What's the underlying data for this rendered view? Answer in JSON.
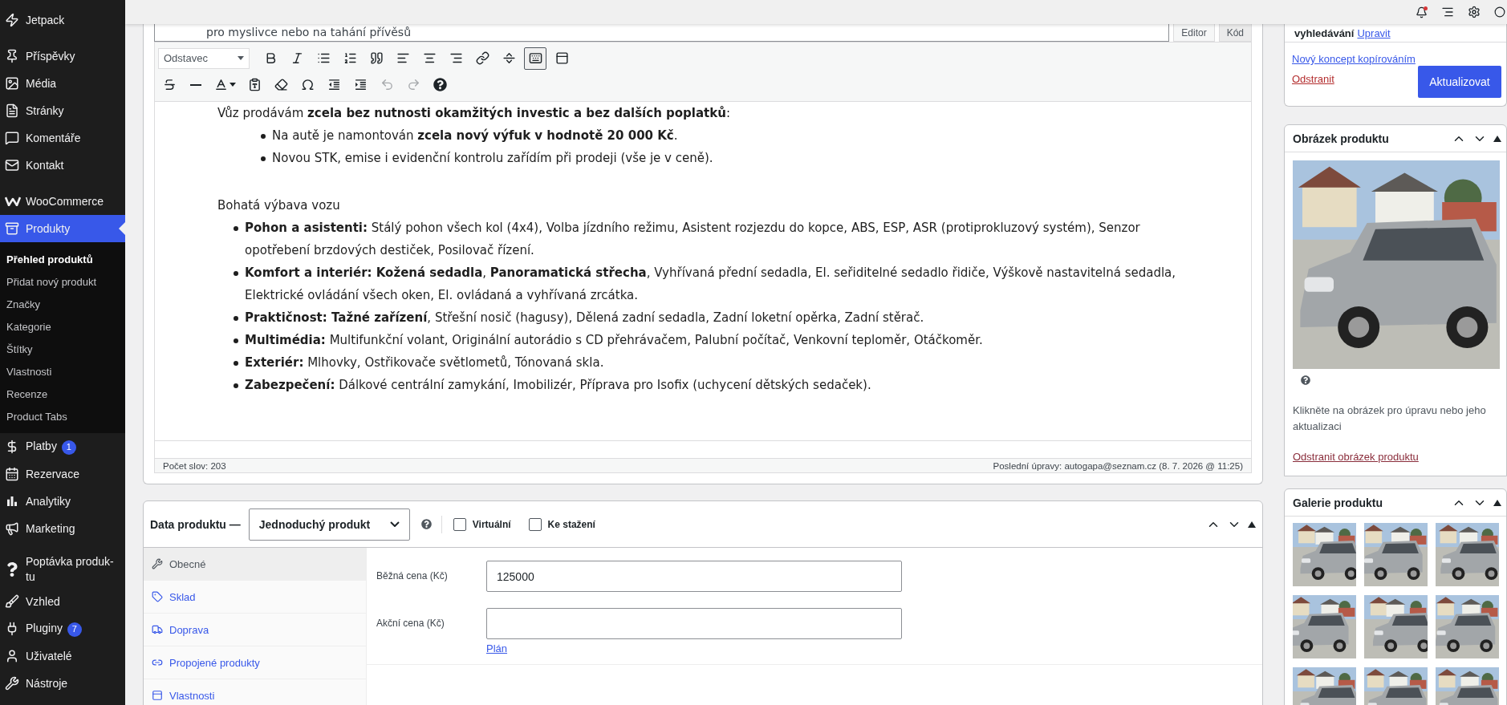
{
  "sidebar": {
    "groups": [
      {
        "items": [
          {
            "label": "Jetpack",
            "selected": false
          }
        ]
      },
      {
        "items": [
          {
            "label": "Příspěvky",
            "selected": false
          },
          {
            "label": "Média",
            "selected": false
          },
          {
            "label": "Stránky",
            "selected": false
          },
          {
            "label": "Komentáře",
            "selected": false
          },
          {
            "label": "Kontakt",
            "selected": false
          }
        ]
      },
      {
        "items": [
          {
            "label": "WooCommerce",
            "selected": false
          },
          {
            "label": "Produkty",
            "selected": true,
            "submenu": [
              {
                "label": "Přehled produktů",
                "selected": true
              },
              {
                "label": "Přidat nový produkt",
                "selected": false
              },
              {
                "label": "Značky",
                "selected": false
              },
              {
                "label": "Kategorie",
                "selected": false
              },
              {
                "label": "Štítky",
                "selected": false
              },
              {
                "label": "Vlastnosti",
                "selected": false
              },
              {
                "label": "Recenze",
                "selected": false
              },
              {
                "label": "Product Tabs",
                "selected": false
              }
            ]
          },
          {
            "label": "Platby",
            "selected": false,
            "badge": "1"
          },
          {
            "label": "Rezervace",
            "selected": false
          },
          {
            "label": "Analytiky",
            "selected": false
          },
          {
            "label": "Marketing",
            "selected": false
          }
        ]
      },
      {
        "items": [
          {
            "label": "Poptávka produk-tu",
            "selected": false
          },
          {
            "label": "Vzhled",
            "selected": false
          },
          {
            "label": "Pluginy",
            "selected": false,
            "badge": "7"
          },
          {
            "label": "Uživatelé",
            "selected": false
          },
          {
            "label": "Nástroje",
            "selected": false
          }
        ]
      }
    ]
  },
  "editor": {
    "above_text": "pro myslivce nebo na tahání přívěsů",
    "modes": [
      {
        "label": "Editor",
        "selected": true
      },
      {
        "label": "Kód",
        "selected": false
      }
    ],
    "format": "Odstavec",
    "toolbar": {
      "row_1": [
        {
          "kind": "bold",
          "active": false
        },
        {
          "kind": "italic",
          "active": false
        },
        {
          "kind": "bullet_list",
          "active": false
        },
        {
          "kind": "numbered_list",
          "active": false
        },
        {
          "kind": "blockquote",
          "active": false
        },
        {
          "kind": "align_left",
          "active": false
        },
        {
          "kind": "align_center",
          "active": false
        },
        {
          "kind": "align_right",
          "active": false
        },
        {
          "kind": "link",
          "active": false
        },
        {
          "kind": "read_more",
          "active": false
        },
        {
          "kind": "toolbar_toggle",
          "active": true
        },
        {
          "kind": "panel",
          "active": false
        }
      ],
      "row_2": [
        {
          "kind": "strikethrough",
          "disabled": false
        },
        {
          "kind": "horizontal_line",
          "disabled": false
        },
        {
          "kind": "text_color",
          "disabled": false
        },
        {
          "kind": "paste_text",
          "disabled": false
        },
        {
          "kind": "clear_formatting",
          "disabled": false
        },
        {
          "kind": "special_character",
          "disabled": false
        },
        {
          "kind": "outdent",
          "disabled": false
        },
        {
          "kind": "indent",
          "disabled": false
        },
        {
          "kind": "undo",
          "disabled": true
        },
        {
          "kind": "redo",
          "disabled": true
        },
        {
          "kind": "help",
          "disabled": false
        }
      ]
    },
    "content": {
      "intro": "Vůz prodávám **zcela bez nutnosti okamžitých investic a bez dalších poplatků**:",
      "intro_list": [
        "Na autě je namontován **zcela nový výfuk v hodnotě 20 000 Kč**.",
        "Novou STK, emise i evidenční kontrolu zařídím při prodeji (vše je v ceně)."
      ],
      "heading": "Bohatá výbava vozu",
      "features": [
        "**Pohon a asistenti:** Stálý pohon všech kol (4x4), Volba jízdního režimu, Asistent rozjezdu do kopce, ABS, ESP, ASR (protiprokluzový systém), Senzor opotřebení brzdových destiček, Posilovač řízení.",
        "**Komfort a interiér: Kožená sedadla**, **Panoramatická střecha**, Vyhřívaná přední sedadla, El. seřiditelné sedadlo řidiče, Výškově nastavitelná sedadla, Elektrické ovládání všech oken, El. ovládaná a vyhřívaná zrcátka.",
        "**Praktičnost: Tažné zařízení**, Střešní nosič (hagusy), Dělená zadní sedadla, Zadní loketní opěrka, Zadní stěrač.",
        "**Multimédia:** Multifunkční volant, Originální autorádio s CD přehrávačem, Palubní počítač, Venkovní teploměr, Otáčkoměr.",
        "**Exteriér:** Mlhovky, Ostřikovače světlometů, Tónovaná skla.",
        "**Zabezpečení:** Dálkové centrální zamykání, Imobilizér, Příprava pro Isofix (uchycení dětských sedaček)."
      ]
    },
    "status": {
      "word_count": "Počet slov: 203",
      "last_edit": "Poslední úpravy: autogapa@seznam.cz (8. 7. 2026 @ 11:25)"
    }
  },
  "product_data": {
    "title": "Data produktu —",
    "type_select": "Jednoduchý produkt",
    "options": [
      {
        "label": "Virtuální",
        "checked": false
      },
      {
        "label": "Ke stažení",
        "checked": false
      }
    ],
    "tabs": [
      {
        "label": "Obecné",
        "selected": true
      },
      {
        "label": "Sklad",
        "selected": false
      },
      {
        "label": "Doprava",
        "selected": false
      },
      {
        "label": "Propojené produkty",
        "selected": false
      },
      {
        "label": "Vlastnosti",
        "selected": false
      }
    ],
    "fields": [
      {
        "label": "Běžná cena (Kč)",
        "value": "125000"
      },
      {
        "label": "Akční cena (Kč)",
        "link": "Plán"
      }
    ]
  },
  "publish_box": {
    "text": "vyhledávání",
    "edit_link": "Upravit",
    "copy_link": "Nový koncept kopírováním",
    "delete_link": "Odstranit",
    "button": "Aktualizovat"
  },
  "product_image": {
    "title": "Obrázek produktu",
    "hint": "Klikněte na obrázek pro úpravu nebo jeho aktualizaci",
    "remove_link": "Odstranit obrázek produktu"
  },
  "gallery": {
    "title": "Galerie produktu"
  }
}
